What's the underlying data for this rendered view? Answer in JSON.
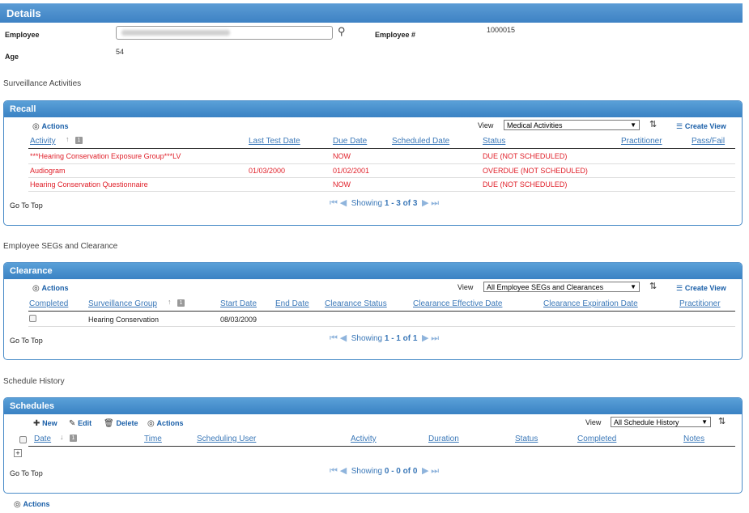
{
  "details": {
    "title": "Details"
  },
  "employee": {
    "employee_label": "Employee",
    "employee_number_label": "Employee #",
    "employee_number": "1000015",
    "age_label": "Age",
    "age": "54"
  },
  "surveillance": {
    "heading": "Surveillance Activities",
    "recall": {
      "title": "Recall",
      "actions_label": "Actions",
      "view_label": "View",
      "view_value": "Medical Activities",
      "create_view_label": "Create View",
      "columns": [
        "Activity",
        "Last Test Date",
        "Due Date",
        "Scheduled Date",
        "Status",
        "Practitioner",
        "Pass/Fail"
      ],
      "rows": [
        {
          "activity": "***Hearing Conservation Exposure Group***LV",
          "last_test": "",
          "due": "NOW",
          "scheduled": "",
          "status": "DUE (NOT SCHEDULED)"
        },
        {
          "activity": "Audiogram",
          "last_test": "01/03/2000",
          "due": "01/02/2001",
          "scheduled": "",
          "status": "OVERDUE (NOT SCHEDULED)"
        },
        {
          "activity": "Hearing Conservation Questionnaire",
          "last_test": "",
          "due": "NOW",
          "scheduled": "",
          "status": "DUE (NOT SCHEDULED)"
        }
      ],
      "go_to_top": "Go To Top",
      "showing_prefix": "Showing",
      "showing_range": "1 - 3 of 3"
    }
  },
  "segs": {
    "heading": "Employee SEGs and Clearance",
    "clearance": {
      "title": "Clearance",
      "actions_label": "Actions",
      "view_label": "View",
      "view_value": "All Employee SEGs and Clearances",
      "create_view_label": "Create View",
      "columns": [
        "Completed",
        "Surveillance Group",
        "Start Date",
        "End Date",
        "Clearance Status",
        "Clearance Effective Date",
        "Clearance Expiration Date",
        "Practitioner"
      ],
      "rows": [
        {
          "group": "Hearing Conservation",
          "start": "08/03/2009"
        }
      ],
      "go_to_top": "Go To Top",
      "showing_prefix": "Showing",
      "showing_range": "1 - 1 of 1"
    }
  },
  "schedule": {
    "heading": "Schedule History",
    "schedules": {
      "title": "Schedules",
      "new_label": "New",
      "edit_label": "Edit",
      "delete_label": "Delete",
      "actions_label": "Actions",
      "view_label": "View",
      "view_value": "All Schedule History",
      "columns": [
        "Date",
        "Time",
        "Scheduling User",
        "Activity",
        "Duration",
        "Status",
        "Completed",
        "Notes"
      ],
      "go_to_top": "Go To Top",
      "showing_prefix": "Showing",
      "showing_range": "0 - 0 of 0"
    }
  },
  "footer": {
    "actions_label": "Actions"
  },
  "badge_text": "1"
}
